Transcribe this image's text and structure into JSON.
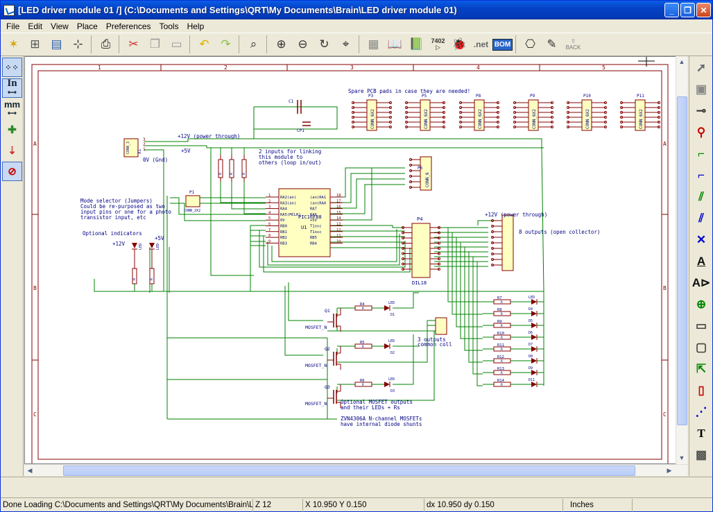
{
  "window": {
    "title": "[LED driver module 01 /] (C:\\Documents and Settings\\QRT\\My Documents\\Brain\\LED driver module 01)"
  },
  "menu": [
    "File",
    "Edit",
    "View",
    "Place",
    "Preferences",
    "Tools",
    "Help"
  ],
  "toolbar": {
    "icons": [
      "new-sheet-icon",
      "hierarchy-icon",
      "save-icon",
      "page-settings-icon",
      "print-icon",
      "cut-icon",
      "copy-icon",
      "paste-icon",
      "undo-icon",
      "redo-icon",
      "find-icon",
      "zoom-in-icon",
      "zoom-out-icon",
      "redraw-icon",
      "zoom-fit-icon",
      "hierarchy-nav-icon",
      "library-editor-icon",
      "library-browser-icon",
      "netlist-icon",
      "erc-icon",
      "net-icon",
      "bom-icon",
      "footprint-icon",
      "annotate-icon",
      "back-icon"
    ],
    "netlist_badge": "7402",
    "net_label": ".net",
    "bom_label": "BOM",
    "back_label": "BACK"
  },
  "left_tools": {
    "units_in": "In",
    "units_mm": "mm"
  },
  "right_tools": {
    "text_label": "A",
    "text2_label": "T"
  },
  "schematic": {
    "border_cols": [
      "1",
      "2",
      "3",
      "4",
      "5"
    ],
    "border_rows": [
      "A",
      "B",
      "C"
    ],
    "notes": {
      "spare": "Spare PCB pads in case they are needed!",
      "power_through": "+12V (power through)",
      "plus5v": "+5V",
      "zero_v": "0V (Gnd)",
      "two_inputs_1": "2 inputs for linking",
      "two_inputs_2": "this module to",
      "two_inputs_3": "others (loop in/out)",
      "mode1": "Mode selector (Jumpers)",
      "mode2": "Could be re-purposed as two",
      "mode3": "input pins or one for a photo",
      "mode4": "transistor input, etc",
      "opt_ind": "Optional indicators",
      "plus12v": "+12V",
      "plus5v_b": "+5V",
      "power_through_2": "+12V (power through)",
      "outputs8": "8 outputs (open collector)",
      "outputs3_1": "3 outputs",
      "outputs3_2": "common coll",
      "mosfet1": "Optional MOSFET outputs",
      "mosfet2": "and their LEDs + Rs",
      "zvn1": "ZVN4306A N-channel MOSFETs",
      "zvn2": "have internal diode shunts"
    },
    "refs": {
      "u1": "U1",
      "u1_value": "PIC16F88",
      "p4": "P4",
      "p4_value": "DIL18",
      "p1": "P1",
      "p1_value": "CONN_2X2",
      "q1": "Q1",
      "q2": "Q2",
      "q3": "Q3",
      "mosfet": "MOSFET_N",
      "c1": "C1",
      "cp1": "CP1",
      "p3": "P3",
      "p5": "P5",
      "p8": "P8",
      "p9": "P9",
      "p10": "P10",
      "p11": "P11",
      "conn_6x2": "CONN_6X2",
      "p6": "P6",
      "conn_6": "CONN_6",
      "x1": "X1",
      "conn_3": "CONN_3",
      "led": "LED",
      "r": "R"
    },
    "u1_pins_left": [
      "RA2(an)",
      "RA3(an)",
      "RA4",
      "RA5(MCLR)",
      "0V",
      "RB0",
      "RB1",
      "RB2",
      "RB3"
    ],
    "u1_pins_right": [
      "(an)RA1",
      "(an)RA0",
      "RA7",
      "RA6",
      "+5V",
      "T1osc",
      "T1osc",
      "RB5",
      "RB4"
    ],
    "u1_pinnums_left": [
      "1",
      "2",
      "3",
      "4",
      "5",
      "6",
      "7",
      "8",
      "9"
    ],
    "u1_pinnums_right": [
      "18",
      "17",
      "16",
      "15",
      "14",
      "13",
      "12",
      "11",
      "10"
    ],
    "out_resistors": [
      "R7",
      "R8",
      "R9",
      "R10",
      "R11",
      "R12",
      "R13",
      "R14"
    ],
    "out_leds": [
      "LED",
      "D4",
      "D5",
      "D6",
      "D7",
      "D8",
      "D9",
      "D11"
    ],
    "mosfet_rows": [
      {
        "q": "Q1",
        "r": "R4",
        "d": "D1"
      },
      {
        "q": "Q2",
        "r": "R5",
        "d": "D2"
      },
      {
        "q": "Q3",
        "r": "R6",
        "d": "D3"
      }
    ]
  },
  "status": {
    "message": "Done Loading C:\\Documents and Settings\\QRT\\My Documents\\Brain\\LE...",
    "zoom": "Z 12",
    "xy": "X 10.950  Y 0.150",
    "dxdy": "dx 10.950  dy 0.150",
    "units": "Inches"
  },
  "colors": {
    "wire": "#008000",
    "component": "#840000",
    "label": "#000084",
    "titlebar": "#0543c5"
  }
}
